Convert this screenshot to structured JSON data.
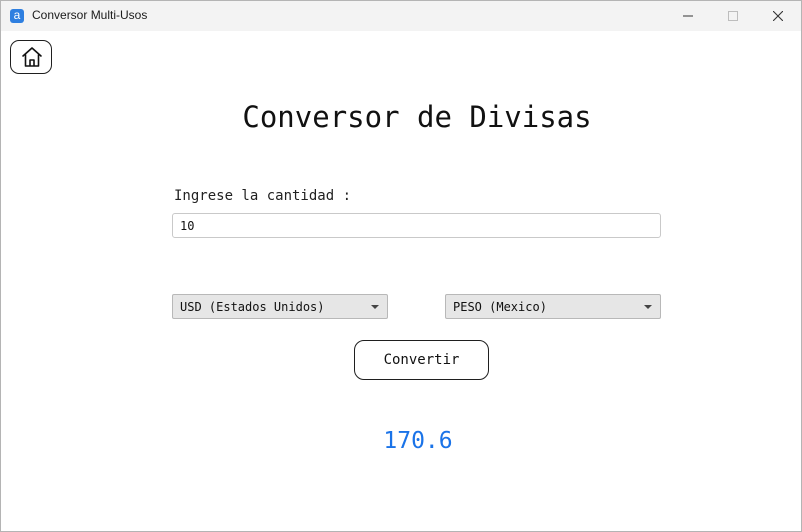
{
  "window": {
    "title": "Conversor Multi-Usos",
    "app_icon_glyph": "a"
  },
  "icons": {
    "app": "app-icon",
    "minimize": "minimize-icon",
    "maximize": "maximize-icon",
    "close": "close-icon",
    "home": "home-icon",
    "dropdown": "chevron-down-icon"
  },
  "main": {
    "title": "Conversor de Divisas",
    "amount_label": "Ingrese la cantidad :",
    "amount_value": "10",
    "from_currency": "USD (Estados Unidos)",
    "to_currency": "PESO (Mexico)",
    "convert_label": "Convertir",
    "result": "170.6"
  },
  "colors": {
    "result": "#1a73e8",
    "app_icon": "#2e7fe0"
  }
}
